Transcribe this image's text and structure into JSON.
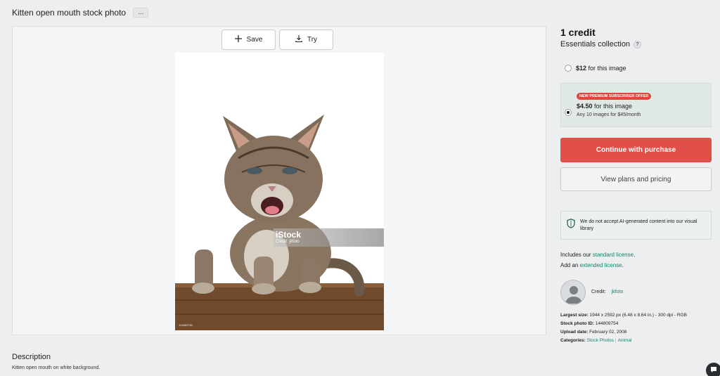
{
  "page": {
    "title": "Kitten open mouth stock photo",
    "more_label": "..."
  },
  "toolbar": {
    "save_label": "Save",
    "try_label": "Try"
  },
  "image": {
    "watermark_brand": "iStock",
    "watermark_credit": "Credit: jkfoto",
    "id_stamp": "144809754"
  },
  "description": {
    "heading": "Description",
    "text": "Kitten open mouth on white background."
  },
  "purchase": {
    "credit": "1 credit",
    "collection": "Essentials collection",
    "help": "?",
    "option1": {
      "price": "$12",
      "suffix": " for this image"
    },
    "option2": {
      "badge": "NEW PREMIUM SUBSCRIBER OFFER",
      "price": "$4.50",
      "suffix": " for this image",
      "sub": "Any 10 images for $45/month"
    },
    "continue_label": "Continue with purchase",
    "plans_label": "View plans and pricing",
    "notice": "We do not accept AI-generated content into our visual library"
  },
  "license": {
    "line1_prefix": "Includes our ",
    "line1_link": "standard license",
    "line1_suffix": ".",
    "line2_prefix": "Add an ",
    "line2_link": "extended license",
    "line2_suffix": "."
  },
  "contributor": {
    "label": "Credit:",
    "name": "jkfoto"
  },
  "meta": {
    "largest_label": "Largest size:",
    "largest_value": " 1944 x 2592 px (6.48 x 8.64 in.) - 300 dpi - RGB",
    "id_label": "Stock photo ID:",
    "id_value": " 144809754",
    "upload_label": "Upload date:",
    "upload_value": " February 02, 2008",
    "categories_label": "Categories:",
    "category1": "Stock Photos",
    "category2": "Animal"
  },
  "colors": {
    "accent": "#e15048",
    "link": "#0e8a67",
    "offer_bg": "#e1e9e6"
  }
}
